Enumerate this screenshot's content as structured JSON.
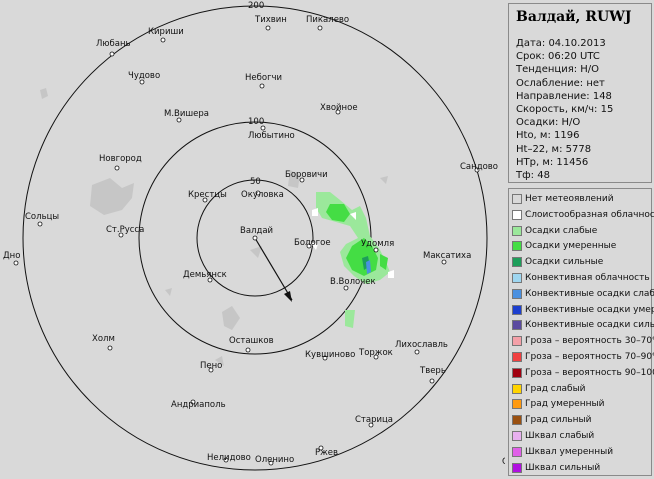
{
  "station": {
    "title": "Валдай, RUWJ"
  },
  "info": [
    "Дата: 04.10.2013",
    "Срок: 06:20 UTC",
    "Тенденция: Н/О",
    "Ослабление: нет",
    "Направление: 148",
    "Скорость, км/ч: 15",
    "Осадки: Н/О",
    "Hto, м: 1196",
    "Ht–22, м: 5778",
    "HTp, м: 11456",
    "Тф: 48"
  ],
  "legend": [
    {
      "label": "Нет метеоявлений",
      "color": "#d9d9d9"
    },
    {
      "label": "Слоистообразная облачность",
      "color": "#ffffff"
    },
    {
      "label": "Осадки слабые",
      "color": "#9be89b"
    },
    {
      "label": "Осадки умеренные",
      "color": "#44dd44"
    },
    {
      "label": "Осадки сильные",
      "color": "#1d9e5a"
    },
    {
      "label": "Конвективная облачность",
      "color": "#9ed6f0"
    },
    {
      "label": "Конвективные осадки слабые",
      "color": "#4a90e0"
    },
    {
      "label": "Конвективные осадки умерен.",
      "color": "#1c3fcf"
    },
    {
      "label": "Конвективные осадки сильные",
      "color": "#5a4aa0"
    },
    {
      "label": "Гроза – вероятность 30–70%",
      "color": "#f4a0a8"
    },
    {
      "label": "Гроза – вероятность 70–90%",
      "color": "#f04040"
    },
    {
      "label": "Гроза – вероятность 90–100%",
      "color": "#a00010"
    },
    {
      "label": "Град слабый",
      "color": "#ffd400"
    },
    {
      "label": "Град умеренный",
      "color": "#ff9a10"
    },
    {
      "label": "Град сильный",
      "color": "#9a5010"
    },
    {
      "label": "Шквал слабый",
      "color": "#e8b0f0"
    },
    {
      "label": "Шквал умеренный",
      "color": "#e060e8"
    },
    {
      "label": "Шквал сильный",
      "color": "#b010e0"
    }
  ],
  "rings": [
    "200",
    "100",
    "50"
  ],
  "cities": [
    {
      "name": "Тихвин"
    },
    {
      "name": "Пикалево"
    },
    {
      "name": "Любань"
    },
    {
      "name": "Кириши"
    },
    {
      "name": "Чудово"
    },
    {
      "name": "Небогчи"
    },
    {
      "name": "М.Вишера"
    },
    {
      "name": "Хвойное"
    },
    {
      "name": "Любытино"
    },
    {
      "name": "Новгород"
    },
    {
      "name": "Боровичи"
    },
    {
      "name": "Сандово"
    },
    {
      "name": "Крестцы"
    },
    {
      "name": "Окуловка"
    },
    {
      "name": "Сольцы"
    },
    {
      "name": "Валдай"
    },
    {
      "name": "Ст.Русса"
    },
    {
      "name": "Бологое"
    },
    {
      "name": "Удомля"
    },
    {
      "name": "Дно"
    },
    {
      "name": "Максатиха"
    },
    {
      "name": "Демьянск"
    },
    {
      "name": "В.Волочек"
    },
    {
      "name": "Холм"
    },
    {
      "name": "Осташков"
    },
    {
      "name": "Кувшиново"
    },
    {
      "name": "Торжок"
    },
    {
      "name": "Лихославль"
    },
    {
      "name": "Пено"
    },
    {
      "name": "Тверь"
    },
    {
      "name": "Андриаполь"
    },
    {
      "name": "Старица"
    },
    {
      "name": "Нелидово"
    },
    {
      "name": "Оленино"
    },
    {
      "name": "Ржев"
    },
    {
      "name": "С"
    }
  ]
}
